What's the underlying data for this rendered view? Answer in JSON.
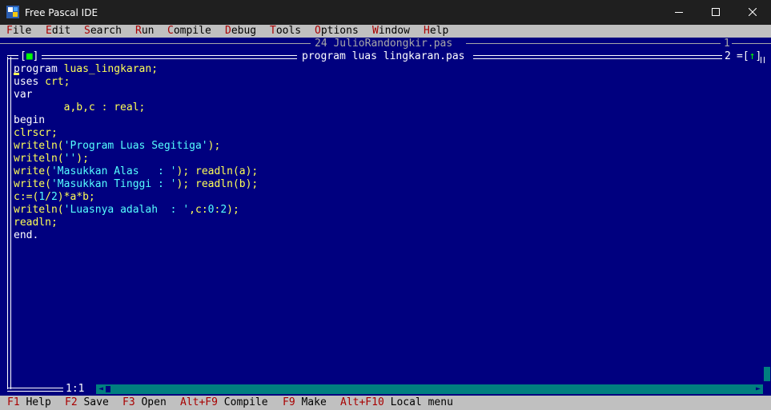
{
  "window": {
    "title": "Free Pascal IDE"
  },
  "menu": {
    "items": [
      {
        "hotkey": "F",
        "rest": "ile"
      },
      {
        "hotkey": "E",
        "rest": "dit"
      },
      {
        "hotkey": "S",
        "rest": "earch"
      },
      {
        "hotkey": "R",
        "rest": "un"
      },
      {
        "hotkey": "C",
        "rest": "ompile"
      },
      {
        "hotkey": "D",
        "rest": "ebug"
      },
      {
        "hotkey": "T",
        "rest": "ools"
      },
      {
        "hotkey": "O",
        "rest": "ptions"
      },
      {
        "hotkey": "W",
        "rest": "indow"
      },
      {
        "hotkey": "H",
        "rest": "elp"
      }
    ]
  },
  "background_window": {
    "title": "24 JulioRandongkir.pas",
    "number": "1"
  },
  "editor": {
    "title": "program luas lingkaran.pas",
    "number": "2",
    "close_box": "■",
    "zoom_arrow": "↑",
    "cursor_position": "1:1",
    "lines": [
      [
        {
          "t": "program ",
          "c": "kw"
        },
        {
          "t": "luas_lingkaran;",
          "c": "id"
        }
      ],
      [
        {
          "t": "uses ",
          "c": "kw"
        },
        {
          "t": "crt;",
          "c": "id"
        }
      ],
      [
        {
          "t": "var",
          "c": "kw"
        }
      ],
      [
        {
          "t": "        a,b,c : real;",
          "c": "id"
        }
      ],
      [
        {
          "t": "begin",
          "c": "kw"
        }
      ],
      [
        {
          "t": "clrscr;",
          "c": "id"
        }
      ],
      [
        {
          "t": "writeln(",
          "c": "id"
        },
        {
          "t": "'Program Luas Segitiga'",
          "c": "str"
        },
        {
          "t": ");",
          "c": "id"
        }
      ],
      [
        {
          "t": "writeln(",
          "c": "id"
        },
        {
          "t": "''",
          "c": "str"
        },
        {
          "t": ");",
          "c": "id"
        }
      ],
      [
        {
          "t": "write(",
          "c": "id"
        },
        {
          "t": "'Masukkan Alas   : '",
          "c": "str"
        },
        {
          "t": "); readln(a);",
          "c": "id"
        }
      ],
      [
        {
          "t": "write(",
          "c": "id"
        },
        {
          "t": "'Masukkan Tinggi : '",
          "c": "str"
        },
        {
          "t": "); readln(b);",
          "c": "id"
        }
      ],
      [
        {
          "t": "c:=(",
          "c": "id"
        },
        {
          "t": "1",
          "c": "num"
        },
        {
          "t": "/",
          "c": "id"
        },
        {
          "t": "2",
          "c": "num"
        },
        {
          "t": ")*a*b;",
          "c": "id"
        }
      ],
      [
        {
          "t": "writeln(",
          "c": "id"
        },
        {
          "t": "'Luasnya adalah  : '",
          "c": "str"
        },
        {
          "t": ",c:",
          "c": "id"
        },
        {
          "t": "0",
          "c": "num"
        },
        {
          "t": ":",
          "c": "id"
        },
        {
          "t": "2",
          "c": "num"
        },
        {
          "t": ");",
          "c": "id"
        }
      ],
      [
        {
          "t": "readln;",
          "c": "id"
        }
      ],
      [
        {
          "t": "end.",
          "c": "kw"
        }
      ]
    ]
  },
  "statusbar": {
    "items": [
      {
        "key": "F1",
        "label": " Help"
      },
      {
        "key": "F2",
        "label": " Save"
      },
      {
        "key": "F3",
        "label": " Open"
      },
      {
        "key": "Alt+F9",
        "label": " Compile"
      },
      {
        "key": "F9",
        "label": " Make"
      },
      {
        "key": "Alt+F10",
        "label": " Local menu"
      }
    ]
  },
  "colors": {
    "desktop": "#00007f",
    "menu_bg": "#c0c0c0",
    "hotkey": "#a80000",
    "keyword": "#ffffff",
    "identifier": "#ffff55",
    "string": "#55ffff",
    "scrollbar": "#007f7f",
    "indicator": "#00ff00"
  }
}
